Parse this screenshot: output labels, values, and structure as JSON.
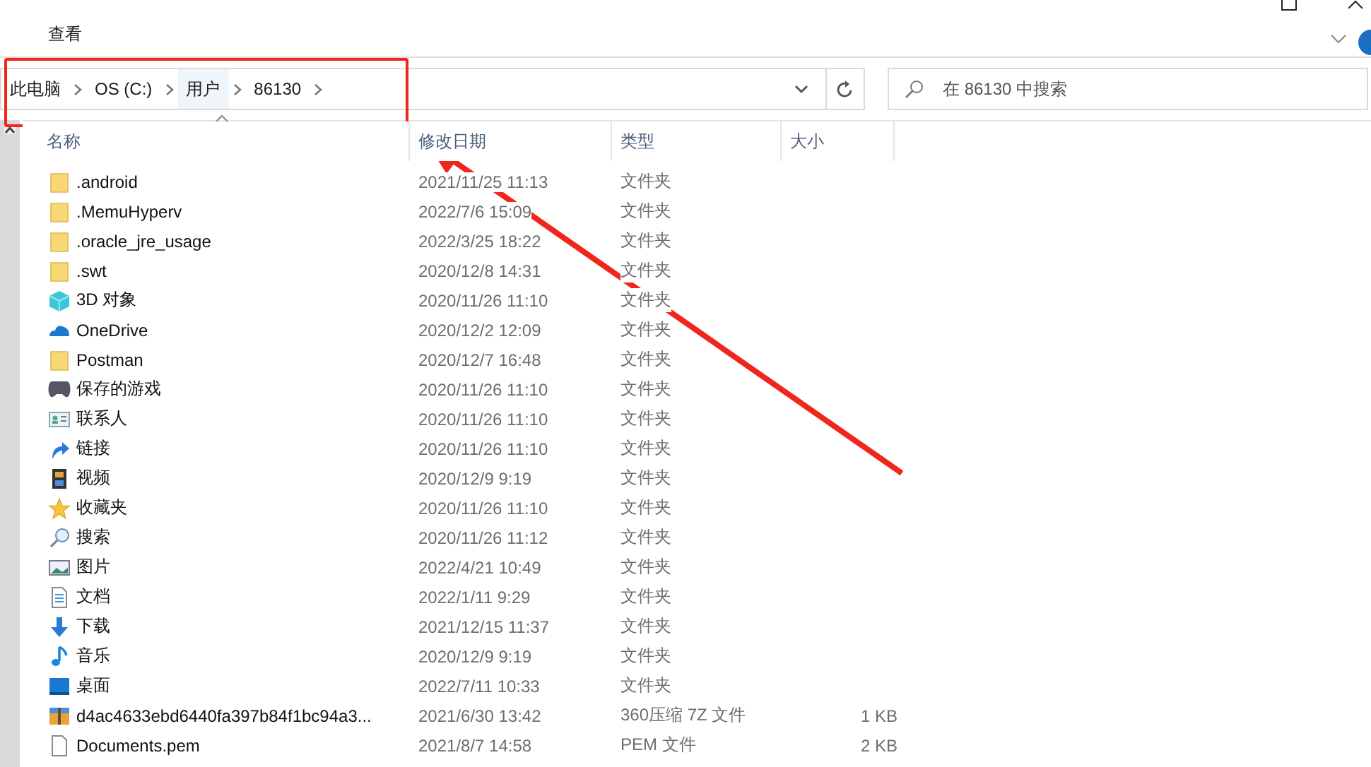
{
  "ribbon": {
    "tabs": [
      {
        "label": "查看",
        "selected": false
      }
    ]
  },
  "address_bar": {
    "crumbs": [
      "此电脑",
      "OS (C:)",
      "用户",
      "86130"
    ],
    "annotated": true
  },
  "search": {
    "placeholder": "在 86130 中搜索"
  },
  "table": {
    "columns": [
      "名称",
      "修改日期",
      "类型",
      "大小"
    ],
    "rows": [
      {
        "kind": "folder",
        "name": ".android",
        "modified": "2021/11/25 11:13",
        "type": "文件夹"
      },
      {
        "kind": "folder",
        "name": ".MemuHyperv",
        "modified": "2022/7/6 15:09",
        "type": "文件夹"
      },
      {
        "kind": "folder",
        "name": ".oracle_jre_usage",
        "modified": "2022/3/25 18:22",
        "type": "文件夹"
      },
      {
        "kind": "folder",
        "name": ".swt",
        "modified": "2020/12/8 14:31",
        "type": "文件夹"
      },
      {
        "kind": "cube",
        "name": "3D 对象",
        "modified": "2020/11/26 11:10",
        "type": "文件夹"
      },
      {
        "kind": "cloud",
        "name": "OneDrive",
        "modified": "2020/12/2 12:09",
        "type": "文件夹"
      },
      {
        "kind": "folder",
        "name": "Postman",
        "modified": "2020/12/7 16:48",
        "type": "文件夹"
      },
      {
        "kind": "game",
        "name": "保存的游戏",
        "modified": "2020/11/26 11:10",
        "type": "文件夹"
      },
      {
        "kind": "contacts",
        "name": "联系人",
        "modified": "2020/11/26 11:10",
        "type": "文件夹"
      },
      {
        "kind": "link",
        "name": "链接",
        "modified": "2020/11/26 11:10",
        "type": "文件夹"
      },
      {
        "kind": "video",
        "name": "视频",
        "modified": "2020/12/9 9:19",
        "type": "文件夹"
      },
      {
        "kind": "star",
        "name": "收藏夹",
        "modified": "2020/11/26 11:10",
        "type": "文件夹"
      },
      {
        "kind": "search",
        "name": "搜索",
        "modified": "2020/11/26 11:12",
        "type": "文件夹"
      },
      {
        "kind": "picture",
        "name": "图片",
        "modified": "2022/4/21 10:49",
        "type": "文件夹"
      },
      {
        "kind": "document",
        "name": "文档",
        "modified": "2022/1/11 9:29",
        "type": "文件夹"
      },
      {
        "kind": "download",
        "name": "下载",
        "modified": "2021/12/15 11:37",
        "type": "文件夹"
      },
      {
        "kind": "music",
        "name": "音乐",
        "modified": "2020/12/9 9:19",
        "type": "文件夹"
      },
      {
        "kind": "desktop",
        "name": "桌面",
        "modified": "2022/7/11 10:33",
        "type": "文件夹"
      },
      {
        "kind": "archive",
        "name": "d4ac4633ebd6440fa397b84f1bc94a3...",
        "modified": "2021/6/30 13:42",
        "type": "360压缩 7Z 文件",
        "size": "1 KB"
      },
      {
        "kind": "file",
        "name": "Documents.pem",
        "modified": "2021/8/7 14:58",
        "type": "PEM 文件",
        "size": "2 KB"
      }
    ]
  }
}
